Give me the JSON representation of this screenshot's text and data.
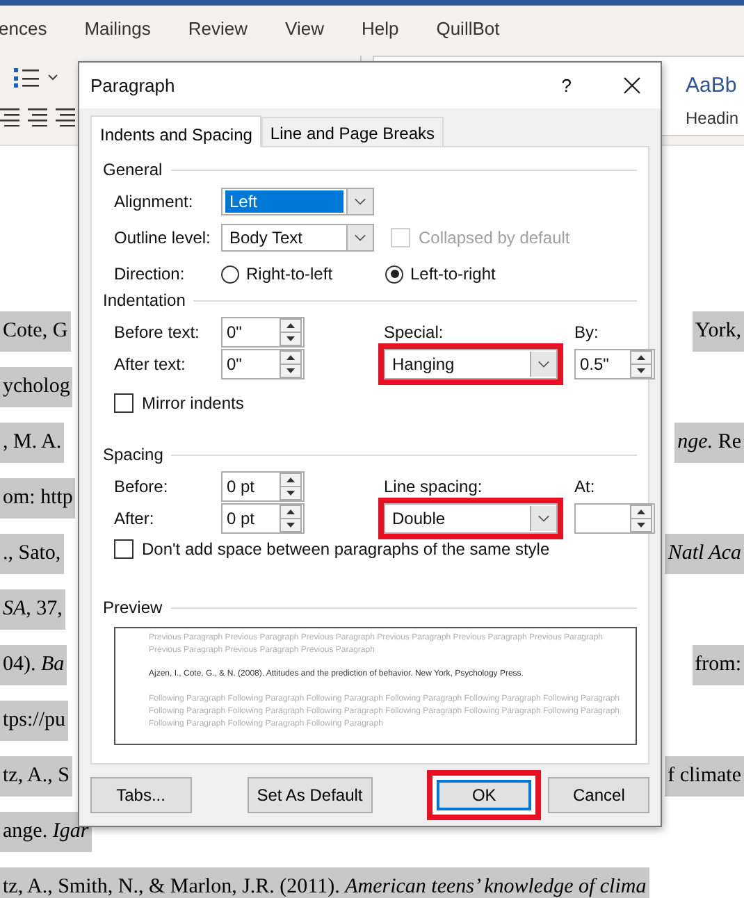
{
  "ribbon": {
    "tabs": [
      "ences",
      "Mailings",
      "Review",
      "View",
      "Help",
      "QuillBot"
    ],
    "styles": [
      {
        "sample": "AaBb",
        "name": "Headin"
      }
    ]
  },
  "document": {
    "lines": [
      {
        "left": "Cote, G",
        "right": "York,"
      },
      {
        "left": "ycholog"
      },
      {
        "left": ", M. A.",
        "right": "*nge.* Re"
      },
      {
        "left": "om: http"
      },
      {
        "left": "., Sato,",
        "right": "*Natl Aca*"
      },
      {
        "left": "*SA*, 37,"
      },
      {
        "left": "04). *Ba*",
        "right": "from:"
      },
      {
        "left": "tps://pu"
      },
      {
        "left": "tz, A., S",
        "right": "f climate"
      },
      {
        "left": "ange. *Igar*"
      },
      {
        "left": "tz, A., Smith, N., & Marlon, J.R. (2011). *American teens’ knowledge of clima*"
      }
    ]
  },
  "dialog": {
    "title": "Paragraph",
    "help": "?",
    "tabs": [
      {
        "label": "Indents and Spacing",
        "selected": true
      },
      {
        "label": "Line and Page Breaks",
        "selected": false
      }
    ],
    "general": {
      "heading": "General",
      "alignment": {
        "label": "Alignment:",
        "value": "Left",
        "focused": true
      },
      "outline_level": {
        "label": "Outline level:",
        "value": "Body Text",
        "focused": false
      },
      "collapsed": {
        "label": "Collapsed by default",
        "checked": false,
        "disabled": true
      },
      "direction": {
        "label": "Direction:",
        "options": [
          {
            "label": "Right-to-left",
            "selected": false
          },
          {
            "label": "Left-to-right",
            "selected": true
          }
        ]
      }
    },
    "indentation": {
      "heading": "Indentation",
      "before": {
        "label": "Before text:",
        "value": "0\""
      },
      "after": {
        "label": "After text:",
        "value": "0\""
      },
      "special": {
        "label": "Special:",
        "value": "Hanging",
        "highlighted": true
      },
      "by": {
        "label": "By:",
        "value": "0.5\""
      },
      "mirror": {
        "label": "Mirror indents",
        "checked": false,
        "disabled": false
      }
    },
    "spacing": {
      "heading": "Spacing",
      "before": {
        "label": "Before:",
        "value": "0 pt"
      },
      "after": {
        "label": "After:",
        "value": "0 pt"
      },
      "line_spacing": {
        "label": "Line spacing:",
        "value": "Double",
        "highlighted": true
      },
      "at": {
        "label": "At:"
      },
      "dont_add": {
        "label": "Don't add space between paragraphs of the same style",
        "checked": false,
        "disabled": false
      }
    },
    "preview": {
      "heading": "Preview",
      "previous": "Previous Paragraph Previous Paragraph Previous Paragraph Previous Paragraph Previous Paragraph Previous Paragraph Previous Paragraph Previous Paragraph Previous Paragraph",
      "sample": "Ajzen, I., Cote, G., & N. (2008). Attitudes and the prediction of behavior. New York, Psychology Press.",
      "following": "Following Paragraph Following Paragraph Following Paragraph Following Paragraph Following Paragraph Following Paragraph Following Paragraph Following Paragraph Following Paragraph Following Paragraph Following Paragraph Following Paragraph Following Paragraph Following Paragraph Following Paragraph"
    },
    "buttons": [
      {
        "label": "Tabs...",
        "highlighted": false,
        "default": false
      },
      {
        "label": "Set As Default",
        "highlighted": false,
        "default": false
      },
      {
        "label": "OK",
        "highlighted": true,
        "default": true
      },
      {
        "label": "Cancel",
        "highlighted": false,
        "default": false
      }
    ]
  }
}
